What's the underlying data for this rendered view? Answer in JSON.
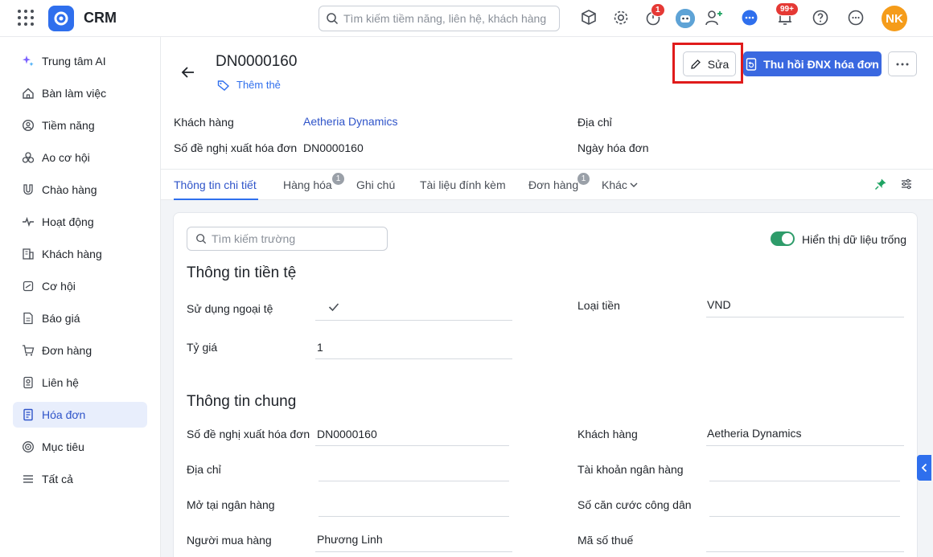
{
  "header": {
    "app_name": "CRM",
    "search_placeholder": "Tìm kiếm tiềm năng, liên hệ, khách hàng",
    "timer_badge": "1",
    "notification_badge": "99+",
    "user_initials": "NK",
    "accent_color": "#3a68e0"
  },
  "sidebar": {
    "items": [
      {
        "label": "Trung tâm AI",
        "icon": "sparkle-icon"
      },
      {
        "label": "Bàn làm việc",
        "icon": "home-icon"
      },
      {
        "label": "Tiềm năng",
        "icon": "target-user-icon"
      },
      {
        "label": "Ao cơ hội",
        "icon": "pool-icon"
      },
      {
        "label": "Chào hàng",
        "icon": "magnet-icon"
      },
      {
        "label": "Hoạt động",
        "icon": "activity-icon"
      },
      {
        "label": "Khách hàng",
        "icon": "building-icon"
      },
      {
        "label": "Cơ hội",
        "icon": "opportunity-icon"
      },
      {
        "label": "Báo giá",
        "icon": "quote-icon"
      },
      {
        "label": "Đơn hàng",
        "icon": "cart-icon"
      },
      {
        "label": "Liên hệ",
        "icon": "contact-icon"
      },
      {
        "label": "Hóa đơn",
        "icon": "invoice-icon"
      },
      {
        "label": "Mục tiêu",
        "icon": "goal-icon"
      },
      {
        "label": "Tất cả",
        "icon": "menu-icon"
      }
    ],
    "active_label": "Hóa đơn"
  },
  "record": {
    "title": "DN0000160",
    "add_tag": "Thêm thẻ",
    "edit_label": "Sửa",
    "primary_action": "Thu hồi ĐNX hóa đơn",
    "summary": {
      "customer_label": "Khách hàng",
      "customer_value": "Aetheria Dynamics",
      "request_no_label": "Số đề nghị xuất hóa đơn",
      "request_no_value": "DN0000160",
      "address_label": "Địa chỉ",
      "invoice_date_label": "Ngày hóa đơn"
    }
  },
  "tabs": {
    "items": [
      "Thông tin chi tiết",
      "Hàng hóa",
      "Ghi chú",
      "Tài liệu đính kèm",
      "Đơn hàng",
      "Khác"
    ],
    "goods_count": "1",
    "orders_count": "1",
    "active": "Thông tin chi tiết"
  },
  "details": {
    "search_placeholder": "Tìm kiếm trường",
    "show_empty_label": "Hiển thị dữ liệu trống",
    "show_empty_on": true,
    "currency_section": {
      "title": "Thông tin tiền tệ",
      "foreign_currency_label": "Sử dụng ngoại tệ",
      "foreign_currency_checked": true,
      "currency_type_label": "Loại tiền",
      "currency_type_value": "VND",
      "exchange_rate_label": "Tỷ giá",
      "exchange_rate_value": "1"
    },
    "general_section": {
      "title": "Thông tin chung",
      "request_no_label": "Số đề nghị xuất hóa đơn",
      "request_no_value": "DN0000160",
      "customer_label": "Khách hàng",
      "customer_value": "Aetheria Dynamics",
      "address_label": "Địa chỉ",
      "bank_account_label": "Tài khoản ngân hàng",
      "bank_open_label": "Mở tại ngân hàng",
      "citizen_id_label": "Số căn cước công dân",
      "buyer_label": "Người mua hàng",
      "buyer_value": "Phương Linh",
      "tax_code_label": "Mã số thuế"
    }
  }
}
